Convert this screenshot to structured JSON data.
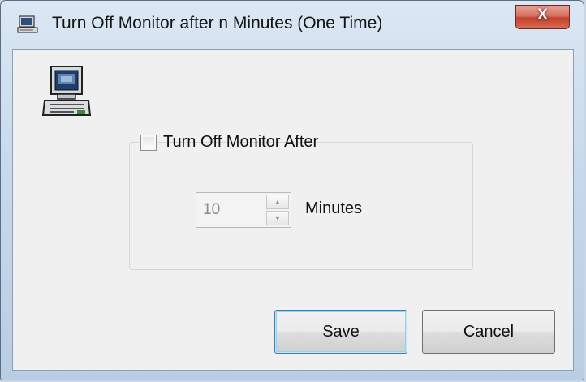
{
  "window": {
    "title": "Turn Off Monitor after n Minutes (One Time)",
    "close_label": "X",
    "icons": {
      "title": "monitor-icon",
      "main": "computer-icon",
      "close": "close-icon"
    }
  },
  "options": {
    "checkbox_label": "Turn Off Monitor After",
    "checkbox_checked": false,
    "minutes_value": "10",
    "minutes_label": "Minutes",
    "enabled": false
  },
  "buttons": {
    "save_label": "Save",
    "cancel_label": "Cancel"
  },
  "colors": {
    "close_accent": "#c2412c",
    "default_button_border": "#3c7fb1"
  }
}
